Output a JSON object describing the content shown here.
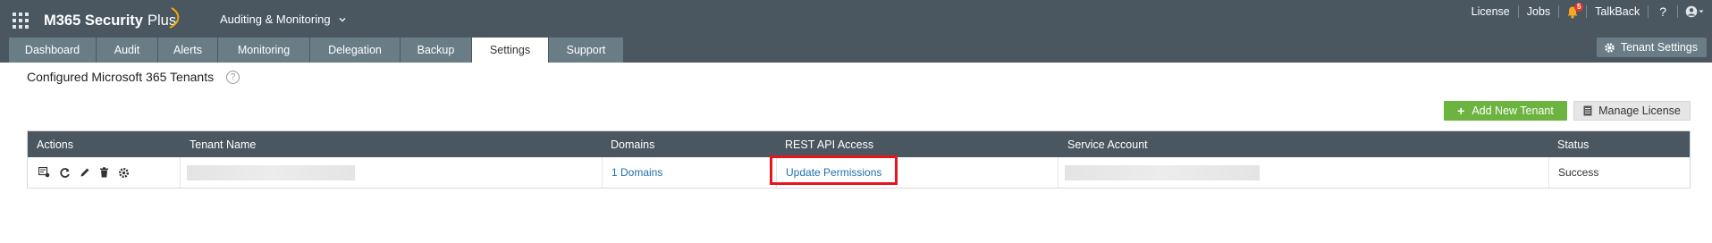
{
  "app": {
    "name": "M365 Security",
    "name_suffix": "Plus",
    "product_switch": "Auditing & Monitoring"
  },
  "top_links": {
    "license": "License",
    "jobs": "Jobs",
    "notification_count": "5",
    "talkback": "TalkBack",
    "help": "?"
  },
  "tabs": [
    {
      "label": "Dashboard"
    },
    {
      "label": "Audit"
    },
    {
      "label": "Alerts"
    },
    {
      "label": "Monitoring"
    },
    {
      "label": "Delegation"
    },
    {
      "label": "Backup"
    },
    {
      "label": "Settings",
      "active": true
    },
    {
      "label": "Support"
    }
  ],
  "tenant_settings_label": "Tenant Settings",
  "page": {
    "title": "Configured Microsoft 365 Tenants",
    "help_icon": "?"
  },
  "buttons": {
    "add_new_tenant": "Add New Tenant",
    "manage_license": "Manage License"
  },
  "table": {
    "headers": [
      "Actions",
      "Tenant Name",
      "Domains",
      "REST API Access",
      "Service Account",
      "Status"
    ],
    "rows": [
      {
        "action_icons": [
          "details-icon",
          "refresh-icon",
          "edit-icon",
          "delete-icon",
          "settings-icon"
        ],
        "tenant_name": "",
        "domains": "1 Domains",
        "rest_api_access": "Update Permissions",
        "service_account": "",
        "status": "Success"
      }
    ]
  },
  "colors": {
    "header_bg": "#4a5761",
    "tab_bg": "#6a7d87",
    "add_button": "#6cb33f",
    "link": "#1f6fa8",
    "highlight": "#e8141c",
    "logo_accent": "#f2a900"
  }
}
